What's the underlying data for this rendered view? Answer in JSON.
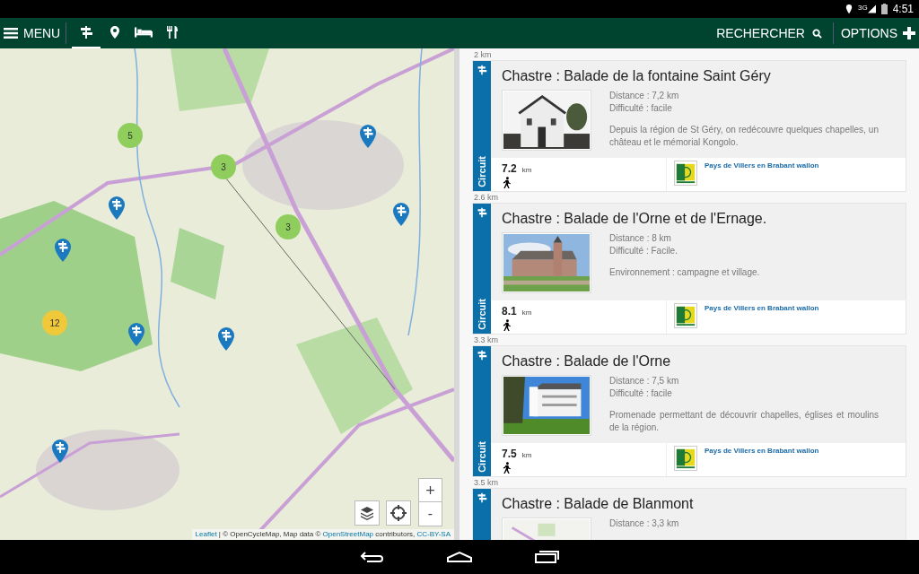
{
  "status_bar": {
    "network": "3G",
    "time": "4:51"
  },
  "app_bar": {
    "menu_label": "MENU",
    "categories": [
      {
        "kind": "signpost",
        "selected": true
      },
      {
        "kind": "pin",
        "selected": false
      },
      {
        "kind": "bed",
        "selected": false
      },
      {
        "kind": "fork",
        "selected": false
      }
    ],
    "search_label": "RECHERCHER",
    "options_label": "OPTIONS"
  },
  "map": {
    "clusters": [
      {
        "count": "5",
        "color": "#8fce5c"
      },
      {
        "count": "3",
        "color": "#8fce5c"
      },
      {
        "count": "3",
        "color": "#8fce5c"
      },
      {
        "count": "12",
        "color": "#f0c93a"
      }
    ],
    "zoom_in": "+",
    "zoom_out": "-",
    "attribution": [
      {
        "text": "Leaflet",
        "kind": "link"
      },
      {
        "text": " | © OpenCycleMap, Map data © ",
        "kind": "plain"
      },
      {
        "text": "OpenStreetMap",
        "kind": "link"
      },
      {
        "text": " contributors, ",
        "kind": "plain"
      },
      {
        "text": "CC-BY-SA",
        "kind": "link"
      }
    ]
  },
  "walks": [
    {
      "distance_away": "2 km",
      "category": "Circuit",
      "title": "Chastre : Balade de la fontaine Saint Géry",
      "distance": "Distance : 7,2 km",
      "difficulty": "Difficulté : facile",
      "description": "Depuis la région de St Géry, on redécouvre quelques chapelles, un château et le mémorial Kongolo.",
      "length": "7.2",
      "unit": "km",
      "organizer": "Pays de Villers en Brabant wallon"
    },
    {
      "distance_away": "2.6 km",
      "category": "Circuit",
      "title": "Chastre : Balade de l'Orne et de l'Ernage.",
      "distance": "Distance : 8 km",
      "difficulty": "Difficulté : Facile.",
      "description": "Environnement : campagne et village.",
      "length": "8.1",
      "unit": "km",
      "organizer": "Pays de Villers en Brabant wallon"
    },
    {
      "distance_away": "3.3 km",
      "category": "Circuit",
      "title": "Chastre : Balade de l'Orne",
      "distance": "Distance : 7,5 km",
      "difficulty": "Difficulté : facile",
      "description": "Promenade permettant de découvrir chapelles, églises et moulins de la région.",
      "length": "7.5",
      "unit": "km",
      "organizer": "Pays de Villers en Brabant wallon"
    },
    {
      "distance_away": "3.5 km",
      "title": "Chastre : Balade de Blanmont",
      "distance": "Distance : 3,3 km"
    }
  ]
}
